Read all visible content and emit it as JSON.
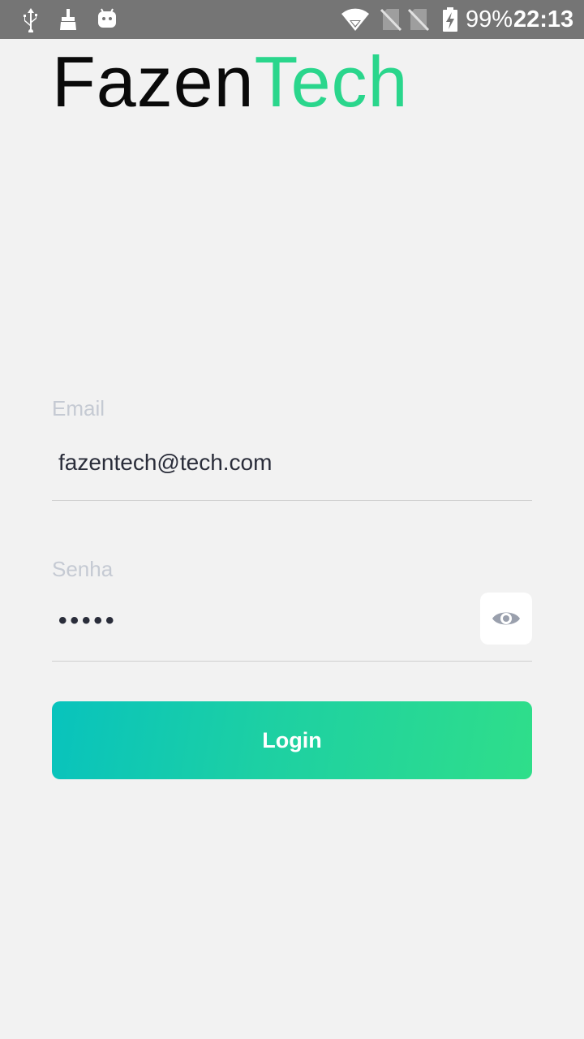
{
  "status_bar": {
    "battery": "99%",
    "time": "22:13",
    "icons": [
      "usb-icon",
      "cleaner-icon",
      "android-icon",
      "wifi-icon",
      "no-sim-icon",
      "no-sim-icon",
      "battery-charging-icon"
    ]
  },
  "logo": {
    "part1": "Fazen",
    "part2": "Tech"
  },
  "form": {
    "email_label": "Email",
    "email_value": "fazentech@tech.com",
    "password_label": "Senha",
    "password_value": "•••••",
    "toggle_icon": "eye-icon",
    "login_label": "Login"
  },
  "colors": {
    "accent_green": "#2ad68c",
    "button_gradient_start": "#08c3bd",
    "button_gradient_end": "#2fde8a",
    "label_gray": "#c5cad3",
    "status_bar": "#757575"
  }
}
